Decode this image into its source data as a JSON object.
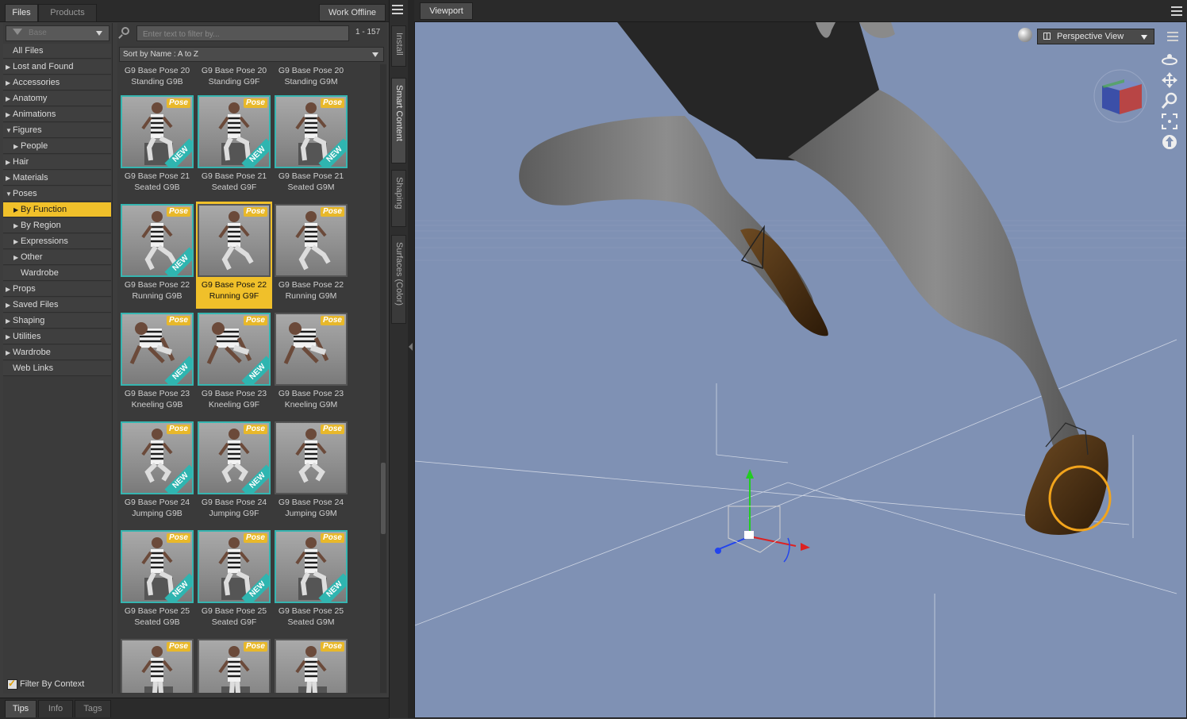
{
  "left_tabs": {
    "files": "Files",
    "products": "Products",
    "work_offline": "Work Offline"
  },
  "categories": {
    "filter_placeholder": "Base",
    "items": [
      {
        "label": "All Files",
        "arrow": "",
        "indent": 0
      },
      {
        "label": "Lost and Found",
        "arrow": "▶",
        "indent": 0
      },
      {
        "label": "Accessories",
        "arrow": "▶",
        "indent": 0
      },
      {
        "label": "Anatomy",
        "arrow": "▶",
        "indent": 0
      },
      {
        "label": "Animations",
        "arrow": "▶",
        "indent": 0
      },
      {
        "label": "Figures",
        "arrow": "▼",
        "indent": 0
      },
      {
        "label": "People",
        "arrow": "▶",
        "indent": 1
      },
      {
        "label": "Hair",
        "arrow": "▶",
        "indent": 0
      },
      {
        "label": "Materials",
        "arrow": "▶",
        "indent": 0
      },
      {
        "label": "Poses",
        "arrow": "▼",
        "indent": 0
      },
      {
        "label": "By Function",
        "arrow": "▶",
        "indent": 1,
        "selected": true
      },
      {
        "label": "By Region",
        "arrow": "▶",
        "indent": 1
      },
      {
        "label": "Expressions",
        "arrow": "▶",
        "indent": 1
      },
      {
        "label": "Other",
        "arrow": "▶",
        "indent": 1
      },
      {
        "label": "Wardrobe",
        "arrow": "",
        "indent": 1
      },
      {
        "label": "Props",
        "arrow": "▶",
        "indent": 0
      },
      {
        "label": "Saved Files",
        "arrow": "▶",
        "indent": 0
      },
      {
        "label": "Shaping",
        "arrow": "▶",
        "indent": 0
      },
      {
        "label": "Utilities",
        "arrow": "▶",
        "indent": 0
      },
      {
        "label": "Wardrobe",
        "arrow": "▶",
        "indent": 0
      },
      {
        "label": "Web Links",
        "arrow": "",
        "indent": 0
      }
    ],
    "filter_by_context": "Filter By Context"
  },
  "grid": {
    "search_placeholder": "Enter text to filter by...",
    "count": "1 - 157",
    "sort": "Sort by Name : A to Z",
    "partial_top": [
      "G9 Base Pose 20\nStanding G9B",
      "G9 Base Pose 20\nStanding G9F",
      "G9 Base Pose 20\nStanding G9M"
    ],
    "rows": [
      [
        {
          "l1": "G9 Base Pose 21",
          "l2": "Seated G9B",
          "new": true,
          "kind": "seated"
        },
        {
          "l1": "G9 Base Pose 21",
          "l2": "Seated G9F",
          "new": true,
          "kind": "seated"
        },
        {
          "l1": "G9 Base Pose 21",
          "l2": "Seated G9M",
          "new": true,
          "kind": "seated"
        }
      ],
      [
        {
          "l1": "G9 Base Pose 22",
          "l2": "Running G9B",
          "new": true,
          "kind": "running"
        },
        {
          "l1": "G9 Base Pose 22",
          "l2": "Running G9F",
          "new": false,
          "kind": "running",
          "selected": true
        },
        {
          "l1": "G9 Base Pose 22",
          "l2": "Running G9M",
          "new": false,
          "kind": "running"
        }
      ],
      [
        {
          "l1": "G9 Base Pose 23",
          "l2": "Kneeling G9B",
          "new": true,
          "kind": "kneeling"
        },
        {
          "l1": "G9 Base Pose 23",
          "l2": "Kneeling G9F",
          "new": true,
          "kind": "kneeling"
        },
        {
          "l1": "G9 Base Pose 23",
          "l2": "Kneeling G9M",
          "new": false,
          "kind": "kneeling"
        }
      ],
      [
        {
          "l1": "G9 Base Pose 24",
          "l2": "Jumping G9B",
          "new": true,
          "kind": "jumping"
        },
        {
          "l1": "G9 Base Pose 24",
          "l2": "Jumping G9F",
          "new": true,
          "kind": "jumping"
        },
        {
          "l1": "G9 Base Pose 24",
          "l2": "Jumping G9M",
          "new": false,
          "kind": "jumping"
        }
      ],
      [
        {
          "l1": "G9 Base Pose 25",
          "l2": "Seated G9B",
          "new": true,
          "kind": "seated"
        },
        {
          "l1": "G9 Base Pose 25",
          "l2": "Seated G9F",
          "new": true,
          "kind": "seated"
        },
        {
          "l1": "G9 Base Pose 25",
          "l2": "Seated G9M",
          "new": true,
          "kind": "seated"
        }
      ],
      [
        {
          "l1": "",
          "l2": "",
          "new": false,
          "kind": "standing"
        },
        {
          "l1": "",
          "l2": "",
          "new": false,
          "kind": "standing"
        },
        {
          "l1": "",
          "l2": "",
          "new": false,
          "kind": "standing"
        }
      ]
    ],
    "pose_badge": "Pose",
    "new_badge": "NEW"
  },
  "bottom_tabs": {
    "tips": "Tips",
    "info": "Info",
    "tags": "Tags"
  },
  "side_tabs": [
    "Install",
    "Smart Content",
    "Shaping",
    "Surfaces (Color)"
  ],
  "viewport": {
    "tab": "Viewport",
    "view_mode": "Perspective View",
    "tools": [
      "orbit-icon",
      "pan-icon",
      "zoom-icon",
      "frame-icon",
      "reset-icon"
    ],
    "colors": {
      "background": "#7f91b4",
      "selection_accent": "#f0c02a",
      "thumb_border": "#36b5b0"
    }
  }
}
